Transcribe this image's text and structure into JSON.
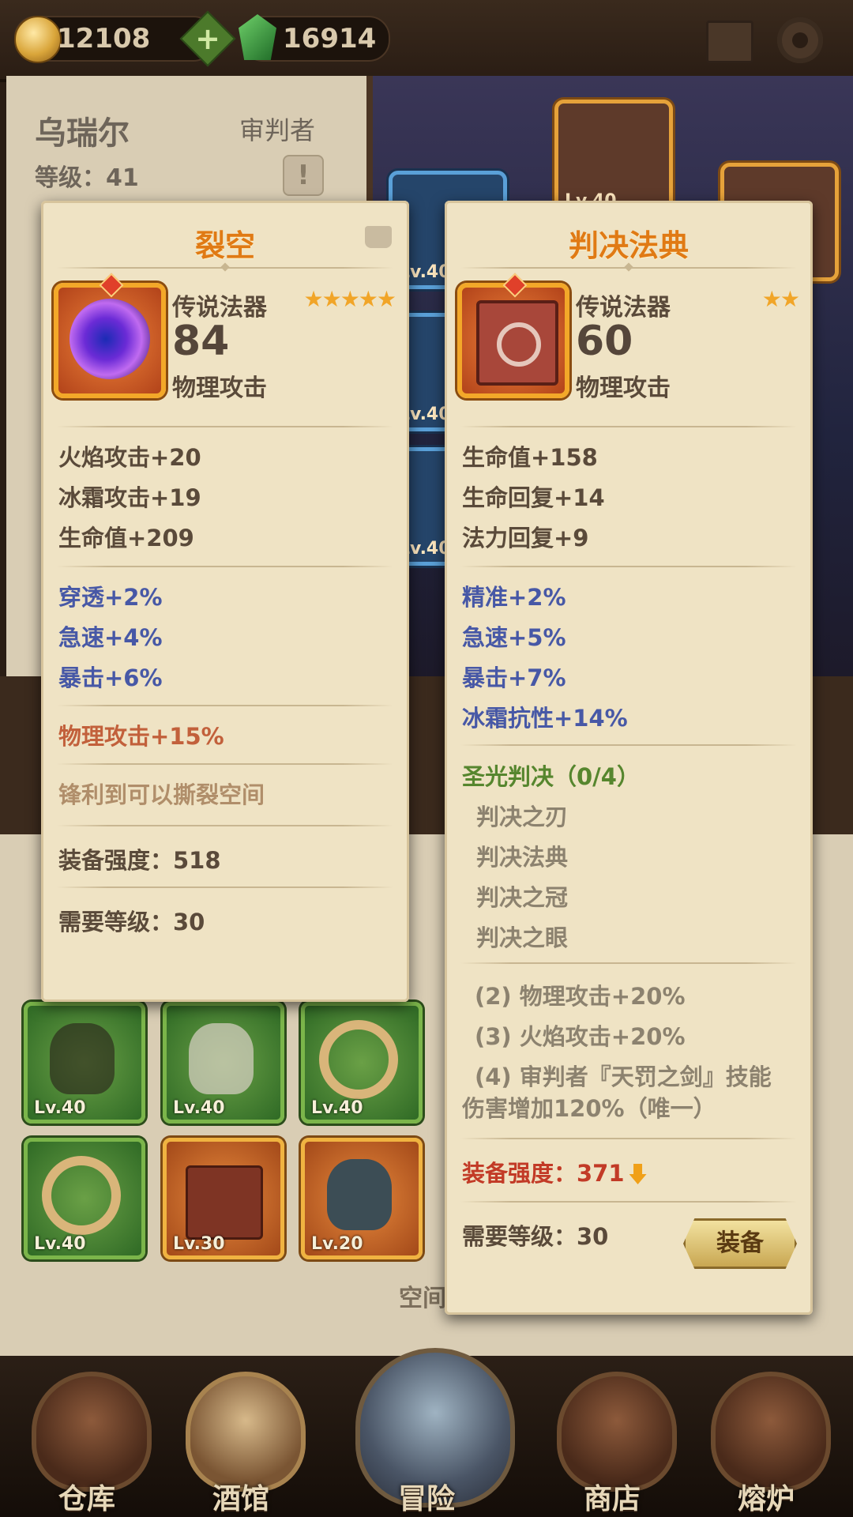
{
  "currency": {
    "gold": "12108",
    "gems": "16914"
  },
  "hero": {
    "name": "乌瑞尔",
    "class": "审判者",
    "level": "等级：41"
  },
  "stage_slots": [
    "Lv.40",
    "Lv.40",
    "Lv.40",
    "Lv.40",
    "Lv.40"
  ],
  "inventory": [
    {
      "level": "Lv.40",
      "rarity": "green",
      "art": "claw"
    },
    {
      "level": "Lv.40",
      "rarity": "green",
      "art": "glove"
    },
    {
      "level": "Lv.40",
      "rarity": "green",
      "art": "ring"
    },
    {
      "level": "Lv.40",
      "rarity": "green",
      "art": "ring"
    },
    {
      "level": "Lv.30",
      "rarity": "orange",
      "art": "book"
    },
    {
      "level": "Lv.20",
      "rarity": "orange",
      "art": "armor"
    }
  ],
  "free_slot_label": "空间",
  "left_card": {
    "title": "裂空",
    "type": "传说法器",
    "stars": "★★★★★",
    "value": "84",
    "stat": "物理攻击",
    "base_stats": [
      "火焰攻击+20",
      "冰霜攻击+19",
      "生命值+209"
    ],
    "bonus_stats": [
      "穿透+2%",
      "急速+4%",
      "暴击+6%"
    ],
    "special": "物理攻击+15%",
    "flavor": "锋利到可以撕裂空间",
    "strength": "装备强度：518",
    "req_level": "需要等级：30"
  },
  "right_card": {
    "title": "判决法典",
    "type": "传说法器",
    "stars": "★★",
    "value": "60",
    "stat": "物理攻击",
    "base_stats": [
      "生命值+158",
      "生命回复+14",
      "法力回复+9"
    ],
    "bonus_stats": [
      "精准+2%",
      "急速+5%",
      "暴击+7%",
      "冰霜抗性+14%"
    ],
    "set_name": "圣光判决（0/4）",
    "set_items": [
      "判决之刃",
      "判决法典",
      "判决之冠",
      "判决之眼"
    ],
    "set_bonuses": [
      "(2) 物理攻击+20%",
      "(3) 火焰攻击+20%",
      "(4) 审判者『天罚之剑』技能",
      "伤害增加120%（唯一）"
    ],
    "strength": "装备强度：371",
    "req_level": "需要等级：30",
    "equip_label": "装备"
  },
  "nav": [
    "仓库",
    "酒馆",
    "冒险",
    "商店",
    "熔炉"
  ]
}
